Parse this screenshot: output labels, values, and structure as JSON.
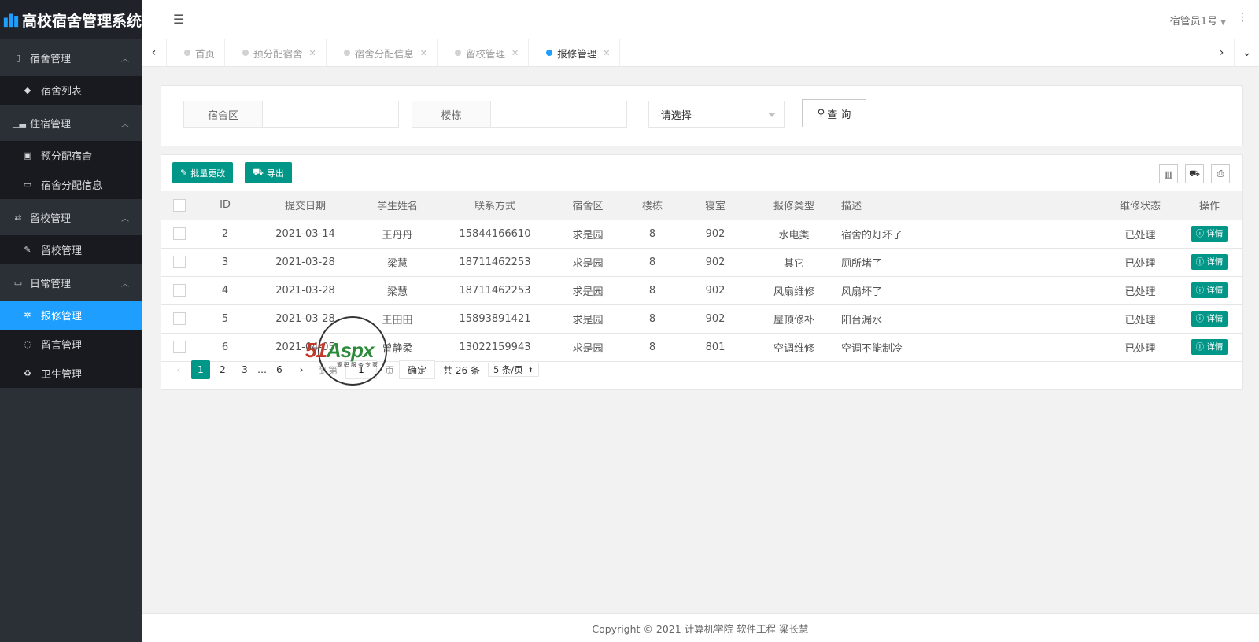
{
  "app": {
    "title": "高校宿舍管理系统"
  },
  "sidebar": {
    "groups": [
      {
        "label": "宿舍管理",
        "icon": "building-icon",
        "items": [
          {
            "label": "宿舍列表",
            "icon": "cube-icon"
          }
        ]
      },
      {
        "label": "住宿管理",
        "icon": "signal-icon",
        "items": [
          {
            "label": "预分配宿舍",
            "icon": "id-card-icon"
          },
          {
            "label": "宿舍分配信息",
            "icon": "bed-icon"
          }
        ]
      },
      {
        "label": "留校管理",
        "icon": "refresh-icon",
        "items": [
          {
            "label": "留校管理",
            "icon": "edit-icon"
          }
        ]
      },
      {
        "label": "日常管理",
        "icon": "laptop-icon",
        "items": [
          {
            "label": "报修管理",
            "icon": "gear-icon",
            "active": true
          },
          {
            "label": "留言管理",
            "icon": "chat-icon"
          },
          {
            "label": "卫生管理",
            "icon": "recycle-icon"
          }
        ]
      }
    ]
  },
  "header": {
    "user": "宿管员1号"
  },
  "tabs": [
    {
      "label": "首页",
      "closable": false
    },
    {
      "label": "预分配宿舍",
      "closable": true
    },
    {
      "label": "宿舍分配信息",
      "closable": true
    },
    {
      "label": "留校管理",
      "closable": true
    },
    {
      "label": "报修管理",
      "closable": true,
      "active": true
    }
  ],
  "search": {
    "area_label": "宿舍区",
    "area_value": "",
    "building_label": "楼栋",
    "building_value": "",
    "select_value": "-请选择-",
    "query_label": "查 询"
  },
  "toolbar": {
    "batch_label": "批量更改",
    "export_label": "导出"
  },
  "table": {
    "headers": [
      "ID",
      "提交日期",
      "学生姓名",
      "联系方式",
      "宿舍区",
      "楼栋",
      "寝室",
      "报修类型",
      "描述",
      "维修状态",
      "操作"
    ],
    "rows": [
      {
        "id": "2",
        "date": "2021-03-14",
        "name": "王丹丹",
        "phone": "15844166610",
        "area": "求是园",
        "building": "8",
        "room": "902",
        "type": "水电类",
        "desc": "宿舍的灯坏了",
        "status": "已处理"
      },
      {
        "id": "3",
        "date": "2021-03-28",
        "name": "梁慧",
        "phone": "18711462253",
        "area": "求是园",
        "building": "8",
        "room": "902",
        "type": "其它",
        "desc": "厕所堵了",
        "status": "已处理"
      },
      {
        "id": "4",
        "date": "2021-03-28",
        "name": "梁慧",
        "phone": "18711462253",
        "area": "求是园",
        "building": "8",
        "room": "902",
        "type": "风扇维修",
        "desc": "风扇坏了",
        "status": "已处理"
      },
      {
        "id": "5",
        "date": "2021-03-28",
        "name": "王田田",
        "phone": "15893891421",
        "area": "求是园",
        "building": "8",
        "room": "902",
        "type": "屋顶修补",
        "desc": "阳台漏水",
        "status": "已处理"
      },
      {
        "id": "6",
        "date": "2021-04-05",
        "name": "曾静柔",
        "phone": "13022159943",
        "area": "求是园",
        "building": "8",
        "room": "801",
        "type": "空调维修",
        "desc": "空调不能制冷",
        "status": "已处理"
      }
    ],
    "detail_label": "详情"
  },
  "pager": {
    "pages": [
      "1",
      "2",
      "3",
      "6"
    ],
    "ellipsis": "…",
    "goto_prefix": "到第",
    "goto_value": "1",
    "goto_suffix": "页",
    "confirm": "确定",
    "total": "共 26 条",
    "limit": "5 条/页"
  },
  "watermark": {
    "brand_a": "51",
    "brand_b": "Aspx",
    "sub": "源码服务专家"
  },
  "footer": {
    "text": "Copyright © 2021 计算机学院 软件工程 梁长慧"
  },
  "colors": {
    "accent": "#009688",
    "active_nav": "#1e9fff",
    "sidebar": "#2b2f36"
  }
}
